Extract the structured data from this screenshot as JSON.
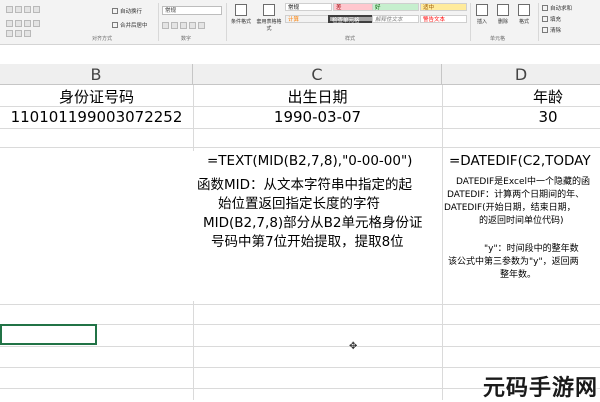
{
  "ribbon": {
    "alignment_group": "对齐方式",
    "wrap_text": "自动换行",
    "merge_center": "合并后居中",
    "number_group": "数字",
    "number_format": "常规",
    "styles_group": "样式",
    "conditional_format": "条件格式",
    "format_as_table": "套用表格格式",
    "style_normal": "常规",
    "style_bad": "差",
    "style_good": "好",
    "style_neutral": "适中",
    "style_calc": "计算",
    "style_check": "检查单元格",
    "style_explain": "解释性文本",
    "style_warning": "警告文本",
    "cells_group": "单元格",
    "insert": "插入",
    "delete": "删除",
    "format": "格式",
    "editing_autosum": "自动求和",
    "editing_fill": "填充",
    "editing_clear": "清除"
  },
  "columns": [
    "B",
    "C",
    "D"
  ],
  "rows": {
    "header": {
      "b": "身份证号码",
      "c": "出生日期",
      "d": "年龄"
    },
    "data": {
      "b": "110101199003072252",
      "c": "1990-03-07",
      "d": "30"
    }
  },
  "notes": {
    "c_formula": "=TEXT(MID(B2,7,8),\"0-00-00\")",
    "c_lines": [
      "函数MID：从文本字符串中指定的起",
      "始位置返回指定长度的字符",
      "MID(B2,7,8)部分从B2单元格身份证",
      "号码中第7位开始提取，提取8位"
    ],
    "d_formula": "=DATEDIF(C2,TODAY",
    "d_lines": [
      "DATEDIF是Excel中一个隐藏的函",
      "DATEDIF：计算两个日期间的年、",
      "DATEDIF(开始日期，结束日期，",
      "的返回时间单位代码)"
    ],
    "d_lines2": [
      "\"y\"：时间段中的整年数",
      "该公式中第三参数为\"y\"，返回两",
      "整年数。"
    ]
  },
  "watermark": "元码手游网",
  "colors": {
    "accent": "#217346",
    "style_bad_bg": "#ffc7ce",
    "style_good_bg": "#c6efce",
    "style_neutral_bg": "#ffeb9c"
  }
}
